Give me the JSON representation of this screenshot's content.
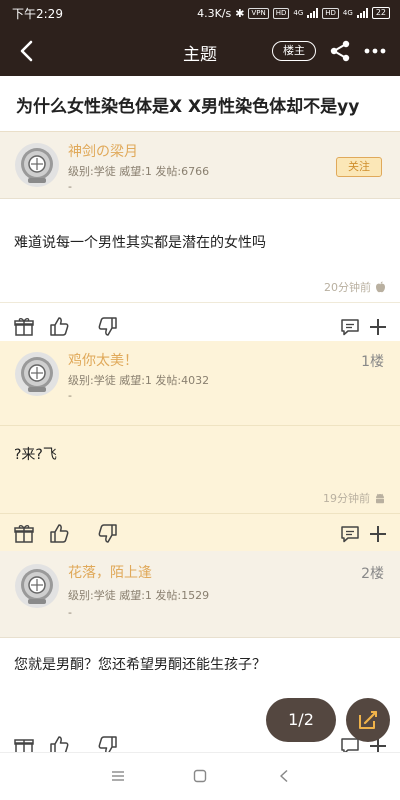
{
  "status_bar": {
    "time": "下午2:29",
    "speed": "4.3K/s",
    "vpn": "VPN",
    "hd1": "HD",
    "net1": "4G",
    "hd2": "HD",
    "net2": "4G",
    "battery": "22"
  },
  "app_bar": {
    "title": "主题",
    "host_label": "楼主"
  },
  "thread": {
    "title": "为什么女性染色体是X X男性染色体却不是yy"
  },
  "posts": [
    {
      "username": "神剑の梁月",
      "meta": "级别:学徒 威望:1 发帖:6766",
      "dash": "-",
      "follow_label": "关注",
      "text": "难道说每一个男性其实都是潜在的女性吗",
      "time": "20分钟前"
    },
    {
      "username": "鸡你太美！",
      "meta": "级别:学徒 威望:1 发帖:4032",
      "dash": "-",
      "floor": "1楼",
      "text": "?来?飞",
      "time": "19分钟前"
    },
    {
      "username": "花落，陌上逢",
      "meta": "级别:学徒 威望:1 发帖:1529",
      "dash": "-",
      "floor": "2楼",
      "text": "您就是男酮？您还希望男酮还能生孩子？"
    }
  ],
  "pager": {
    "label": "1/2"
  },
  "colors": {
    "dark_bar": "#2d211c",
    "username": "#e0a95a",
    "highlight_bg": "#fdf3d9",
    "page_bg": "#f6f1e6"
  }
}
